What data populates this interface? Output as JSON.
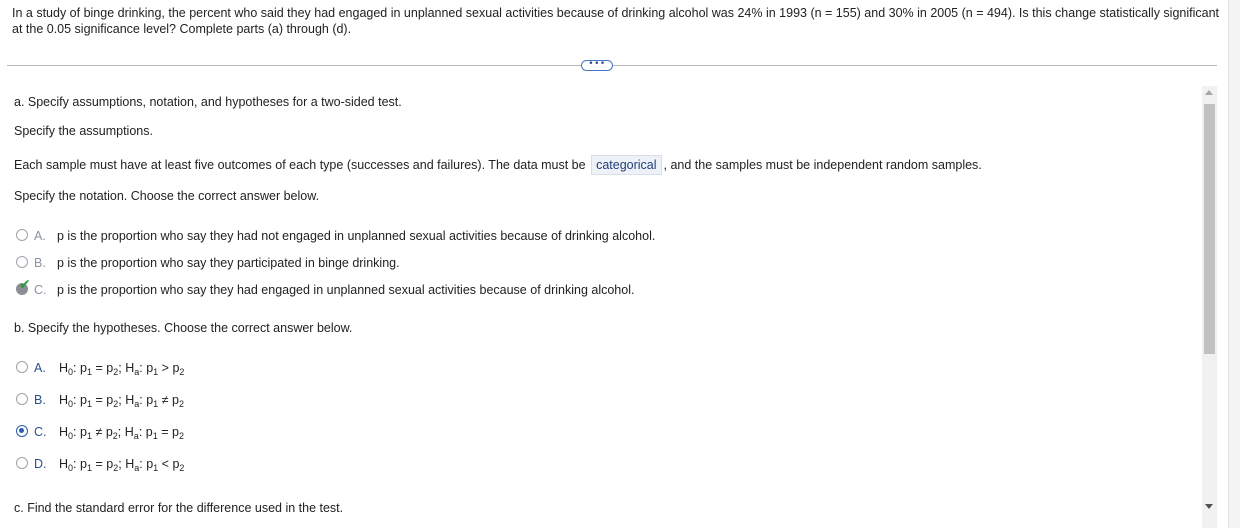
{
  "question": {
    "text": "In a study of binge drinking, the percent who said they had engaged in unplanned sexual activities because of drinking alcohol was 24% in 1993 (n = 155) and 30% in 2005 (n = 494). Is this change statistically significant at the 0.05 significance level? Complete parts (a) through (d)."
  },
  "more_button": {
    "label": "•••"
  },
  "part_a": {
    "heading": "a. Specify assumptions, notation, and hypotheses for a two-sided test.",
    "assumptions_prompt": "Specify the assumptions.",
    "assumption_before": "Each sample must have at least five outcomes of each type (successes and failures). The data must be",
    "assumption_answer": "categorical",
    "assumption_after": ", and the samples must be independent random samples.",
    "notation_prompt": "Specify the notation. Choose the correct answer below.",
    "notation_options": [
      {
        "letter": "A.",
        "text": "p is the proportion who say they had not engaged in unplanned sexual activities because of drinking alcohol.",
        "state": "unselected"
      },
      {
        "letter": "B.",
        "text": "p is the proportion who say they participated in binge drinking.",
        "state": "unselected"
      },
      {
        "letter": "C.",
        "text": "p is the proportion who say they had engaged in unplanned sexual activities because of drinking alcohol.",
        "state": "correct"
      }
    ]
  },
  "part_b": {
    "heading": "b. Specify the hypotheses. Choose the correct answer below.",
    "options": [
      {
        "letter": "A.",
        "h0_rel": "=",
        "ha_rel": ">",
        "state": "unselected"
      },
      {
        "letter": "B.",
        "h0_rel": "=",
        "ha_rel": "≠",
        "state": "unselected"
      },
      {
        "letter": "C.",
        "h0_rel": "≠",
        "ha_rel": "=",
        "state": "selected"
      },
      {
        "letter": "D.",
        "h0_rel": "=",
        "ha_rel": "<",
        "state": "unselected"
      }
    ],
    "symbols": {
      "H": "H",
      "zero": "0",
      "a": "a",
      "p": "p",
      "one": "1",
      "two": "2",
      "colon": ":",
      "semicolon": ";"
    }
  },
  "part_c": {
    "heading": "c. Find the standard error for the difference used in the test."
  },
  "colors": {
    "accent": "#2a5db0",
    "correct_check": "#2f9a38",
    "answer_box": "#eef2f8"
  },
  "icons": {
    "more": "ellipsis-pill-icon",
    "correct": "check-icon",
    "scroll_up": "triangle-up-icon",
    "scroll_down": "triangle-down-icon"
  }
}
